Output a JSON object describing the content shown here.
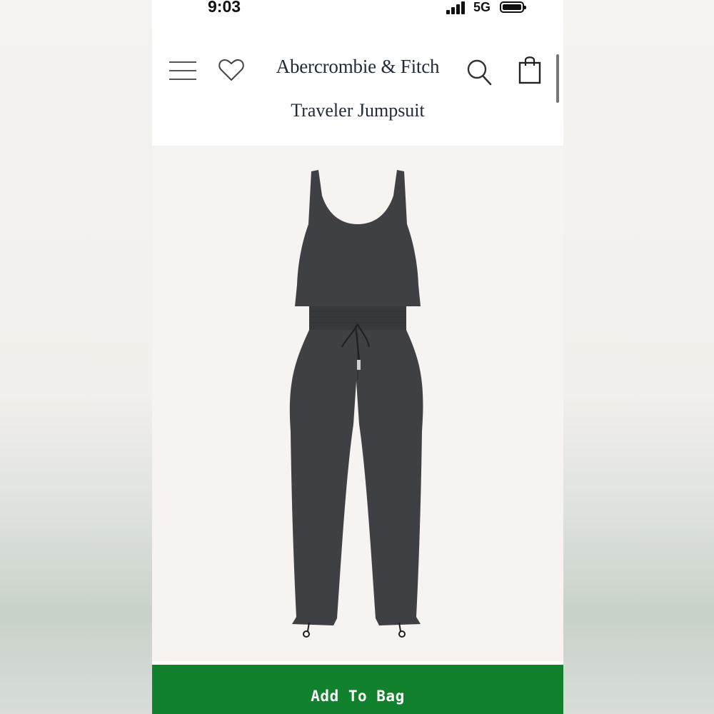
{
  "status_bar": {
    "time": "9:03",
    "network": "5G"
  },
  "header": {
    "brand": "Abercrombie & Fitch",
    "page_title": "Traveler Jumpsuit",
    "icons": [
      "menu-icon",
      "heart-icon",
      "search-icon",
      "bag-icon"
    ]
  },
  "product": {
    "image": "jumpsuit-product-image",
    "color": "#3f4043"
  },
  "cta": {
    "add_to_bag_label": "Add To Bag",
    "color": "#12812e"
  }
}
